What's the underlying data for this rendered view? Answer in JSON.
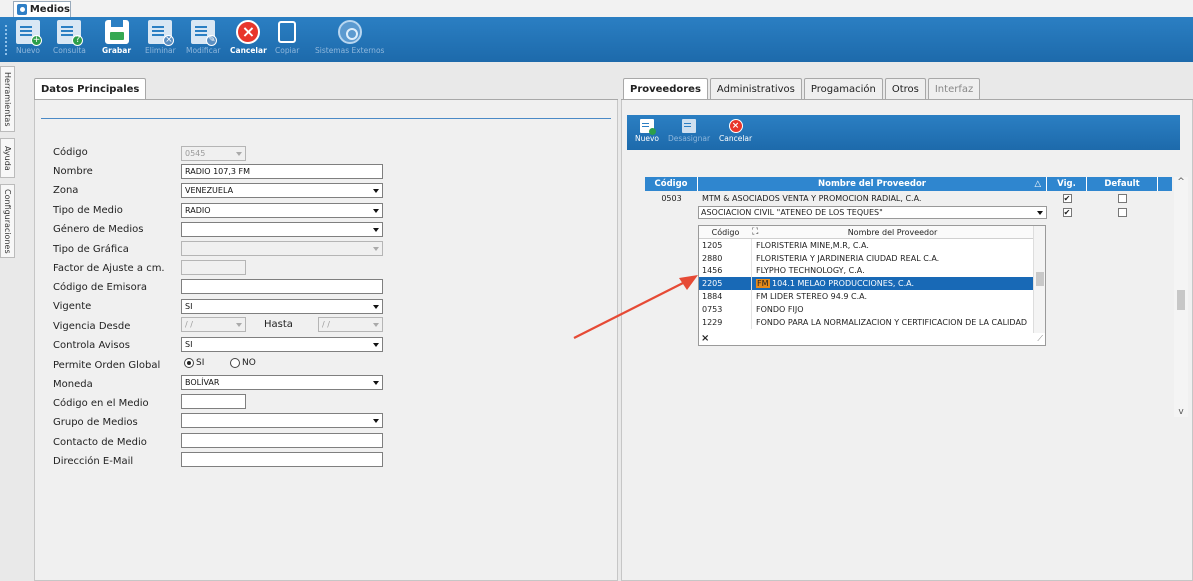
{
  "window_tab": {
    "title": "Medios"
  },
  "toolbar": {
    "buttons": [
      {
        "label": "Nuevo",
        "enabled": false,
        "icon": "new-doc-icon"
      },
      {
        "label": "Consulta",
        "enabled": false,
        "icon": "query-doc-icon"
      },
      {
        "label": "Grabar",
        "enabled": true,
        "icon": "save-icon"
      },
      {
        "label": "Eliminar",
        "enabled": false,
        "icon": "delete-doc-icon"
      },
      {
        "label": "Modificar",
        "enabled": false,
        "icon": "edit-doc-icon"
      },
      {
        "label": "Cancelar",
        "enabled": true,
        "icon": "cancel-icon"
      },
      {
        "label": "Copiar",
        "enabled": false,
        "icon": "copy-icon"
      },
      {
        "label": "Sistemas Externos",
        "enabled": false,
        "icon": "external-systems-icon"
      }
    ]
  },
  "side_tabs": [
    "Herramientas",
    "Ayuda",
    "Configuraciones"
  ],
  "left_panel": {
    "tab": "Datos Principales",
    "labels": {
      "codigo": "Código",
      "nombre": "Nombre",
      "zona": "Zona",
      "tipo_medio": "Tipo de Medio",
      "genero": "Género de Medios",
      "tipo_grafica": "Tipo de Gráfica",
      "factor": "Factor de Ajuste a cm.",
      "emisora": "Código de Emisora",
      "vigente": "Vigente",
      "vigencia_desde": "Vigencia Desde",
      "hasta": "Hasta",
      "controla_avisos": "Controla Avisos",
      "orden_global": "Permite Orden Global",
      "moneda": "Moneda",
      "codigo_medio": "Código en el Medio",
      "grupo": "Grupo de Medios",
      "contacto": "Contacto de Medio",
      "email": "Dirección E-Mail"
    },
    "values": {
      "codigo": "0545",
      "nombre": "RADIO 107,3 FM",
      "zona": "VENEZUELA",
      "tipo_medio": "RADIO",
      "genero": "",
      "tipo_grafica": "",
      "factor": "",
      "emisora": "",
      "vigente": "SI",
      "vigencia_desde": " / / ",
      "hasta": " / / ",
      "controla_avisos": "SI",
      "moneda": "BOLÍVAR",
      "codigo_medio": "",
      "grupo": "",
      "contacto": "",
      "email": ""
    },
    "radio": {
      "si": "SI",
      "no": "NO",
      "selected": "SI"
    }
  },
  "right_panel": {
    "tabs": [
      {
        "label": "Proveedores",
        "active": true,
        "enabled": true
      },
      {
        "label": "Administrativos",
        "active": false,
        "enabled": true
      },
      {
        "label": "Progamación",
        "active": false,
        "enabled": true
      },
      {
        "label": "Otros",
        "active": false,
        "enabled": true
      },
      {
        "label": "Interfaz",
        "active": false,
        "enabled": false
      }
    ],
    "subtoolbar": [
      {
        "label": "Nuevo",
        "enabled": true
      },
      {
        "label": "Desasignar",
        "enabled": false
      },
      {
        "label": "Cancelar",
        "enabled": true
      }
    ],
    "grid": {
      "headers": {
        "codigo": "Código",
        "nombre": "Nombre del Proveedor",
        "vig": "Vig.",
        "default": "Default",
        "sort_indicator": "△"
      },
      "rows": [
        {
          "codigo": "0503",
          "nombre": "MTM & ASOCIADOS VENTA Y PROMOCION RADIAL, C.A.",
          "vig": "✔",
          "default": ""
        }
      ],
      "edit_row": {
        "nombre": "ASOCIACION CIVIL \"ATENEO DE LOS TEQUES\"",
        "vig": "✔",
        "default": ""
      }
    },
    "dropdown": {
      "headers": {
        "codigo": "Código",
        "nombre": "Nombre del Proveedor"
      },
      "rows": [
        {
          "codigo": "1205",
          "prefix": "",
          "nombre": "FLORISTERIA MINE,M.R, C.A."
        },
        {
          "codigo": "2880",
          "prefix": "",
          "nombre": "FLORISTERIA Y JARDINERIA CIUDAD REAL C.A."
        },
        {
          "codigo": "1456",
          "prefix": "",
          "nombre": "FLYPHO TECHNOLOGY, C.A."
        },
        {
          "codigo": "2205",
          "prefix": "FM",
          "nombre": " 104.1 MELAO PRODUCCIONES, C.A."
        },
        {
          "codigo": "1884",
          "prefix": "",
          "nombre": "FM LIDER STEREO 94.9 C.A."
        },
        {
          "codigo": "0753",
          "prefix": "",
          "nombre": "FONDO FIJO"
        },
        {
          "codigo": "1229",
          "prefix": "",
          "nombre": "FONDO PARA LA NORMALIZACION Y CERTIFICACION DE LA CALIDAD"
        }
      ],
      "selected_index": 3,
      "clear_glyph": "×"
    }
  },
  "colors": {
    "toolbar_blue": "#2b7fc3",
    "header_blue": "#2f86cf",
    "selection_blue": "#1869b6",
    "cancel_red": "#e8352b",
    "arrow_red": "#e64a35"
  }
}
